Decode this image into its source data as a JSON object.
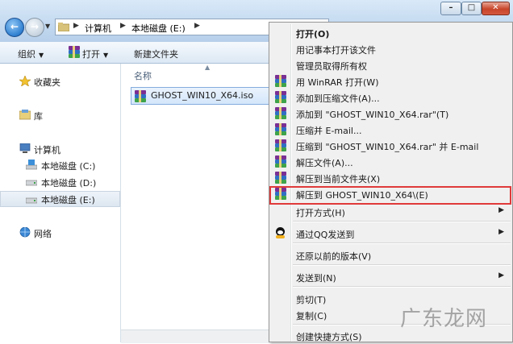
{
  "address": {
    "crumbs": [
      "计算机",
      "本地磁盘 (E:)"
    ]
  },
  "toolbar": {
    "organize": "组织",
    "open": "打开",
    "new_folder": "新建文件夹"
  },
  "sidebar": {
    "favorites": "收藏夹",
    "libraries": "库",
    "computer": "计算机",
    "drives": [
      "本地磁盘 (C:)",
      "本地磁盘 (D:)",
      "本地磁盘 (E:)"
    ],
    "network": "网络",
    "selected": "本地磁盘 (E:)"
  },
  "files": {
    "column_name": "名称",
    "items": [
      {
        "name": "GHOST_WIN10_X64.iso",
        "icon": "winrar-archive-icon"
      }
    ]
  },
  "context_menu": {
    "items": [
      {
        "label": "打开(O)",
        "bold": true
      },
      {
        "label": "用记事本打开该文件"
      },
      {
        "label": "管理员取得所有权"
      },
      {
        "label": "用 WinRAR 打开(W)",
        "icon": "winrar-icon"
      },
      {
        "label": "添加到压缩文件(A)...",
        "icon": "winrar-icon"
      },
      {
        "label": "添加到 \"GHOST_WIN10_X64.rar\"(T)",
        "icon": "winrar-icon"
      },
      {
        "label": "压缩并 E-mail...",
        "icon": "winrar-icon"
      },
      {
        "label": "压缩到 \"GHOST_WIN10_X64.rar\" 并 E-mail",
        "icon": "winrar-icon"
      },
      {
        "label": "解压文件(A)...",
        "icon": "winrar-icon"
      },
      {
        "label": "解压到当前文件夹(X)",
        "icon": "winrar-icon"
      },
      {
        "label": "解压到 GHOST_WIN10_X64\\(E)",
        "icon": "winrar-icon",
        "highlighted": true
      },
      {
        "label": "打开方式(H)",
        "submenu": true
      },
      {
        "label": "通过QQ发送到",
        "icon": "qq-icon",
        "submenu": true
      },
      {
        "label": "还原以前的版本(V)"
      },
      {
        "label": "发送到(N)",
        "submenu": true
      },
      {
        "label": "剪切(T)"
      },
      {
        "label": "复制(C)"
      },
      {
        "label": "创建快捷方式(S)"
      }
    ],
    "highlight_color": "#e03a3a"
  },
  "watermark": "广东龙网"
}
